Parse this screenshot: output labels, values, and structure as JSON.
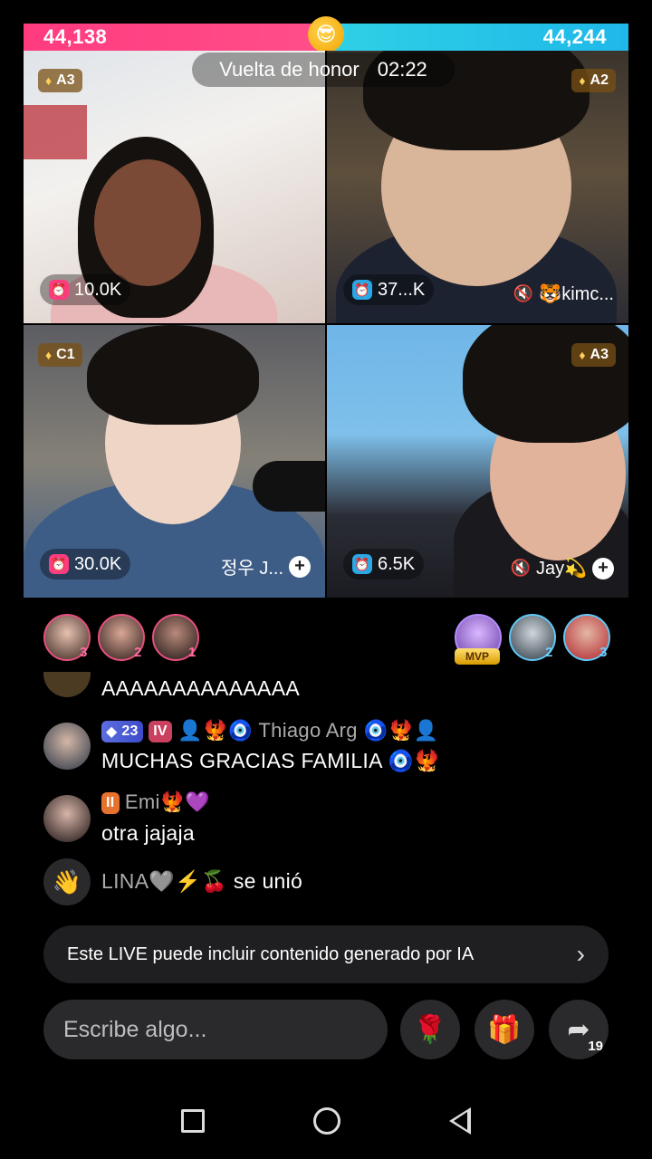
{
  "battle": {
    "score_left": "44,138",
    "score_right": "44,244",
    "center_icon": "sunglasses-emoji-icon",
    "phase_label": "Vuelta de honor",
    "timer": "02:22",
    "colors": {
      "left": "#ff3b7f",
      "right": "#1fb8e8"
    }
  },
  "tiles": [
    {
      "rank": "A3",
      "likes": "10.0K",
      "likes_icon": "pink-alarm-icon",
      "name": ""
    },
    {
      "rank": "A2",
      "likes": "37...K",
      "likes_icon": "blue-alarm-icon",
      "name": "🐯kimc...",
      "muted": true
    },
    {
      "rank": "C1",
      "likes": "30.0K",
      "likes_icon": "pink-alarm-icon",
      "name": "정우 J..."
    },
    {
      "rank": "A3",
      "likes": "6.5K",
      "likes_icon": "blue-alarm-icon",
      "name": "Jay💫",
      "muted": true
    }
  ],
  "viewers": {
    "left": [
      {
        "rank": "3"
      },
      {
        "rank": "2"
      },
      {
        "rank": "1"
      }
    ],
    "right": [
      {
        "rank": "MVP"
      },
      {
        "rank": "2"
      },
      {
        "rank": "3"
      }
    ]
  },
  "chat": [
    {
      "text": "AAAAAAAAAAAAAA"
    },
    {
      "level": "23",
      "fan_badge": "IV",
      "username": "Thiago Arg",
      "text": "MUCHAS GRACIAS FAMILIA 🧿🐦‍🔥"
    },
    {
      "fan_badge": "II",
      "username": "Emi",
      "username_suffix": "🐦‍🔥💜",
      "text": "otra jajaja"
    },
    {
      "username": "LINA🩶⚡️🍒",
      "action": "se unió"
    }
  ],
  "notice": "Este LIVE puede incluir contenido generado por IA",
  "composer": {
    "placeholder": "Escribe algo...",
    "share_count": "19"
  }
}
